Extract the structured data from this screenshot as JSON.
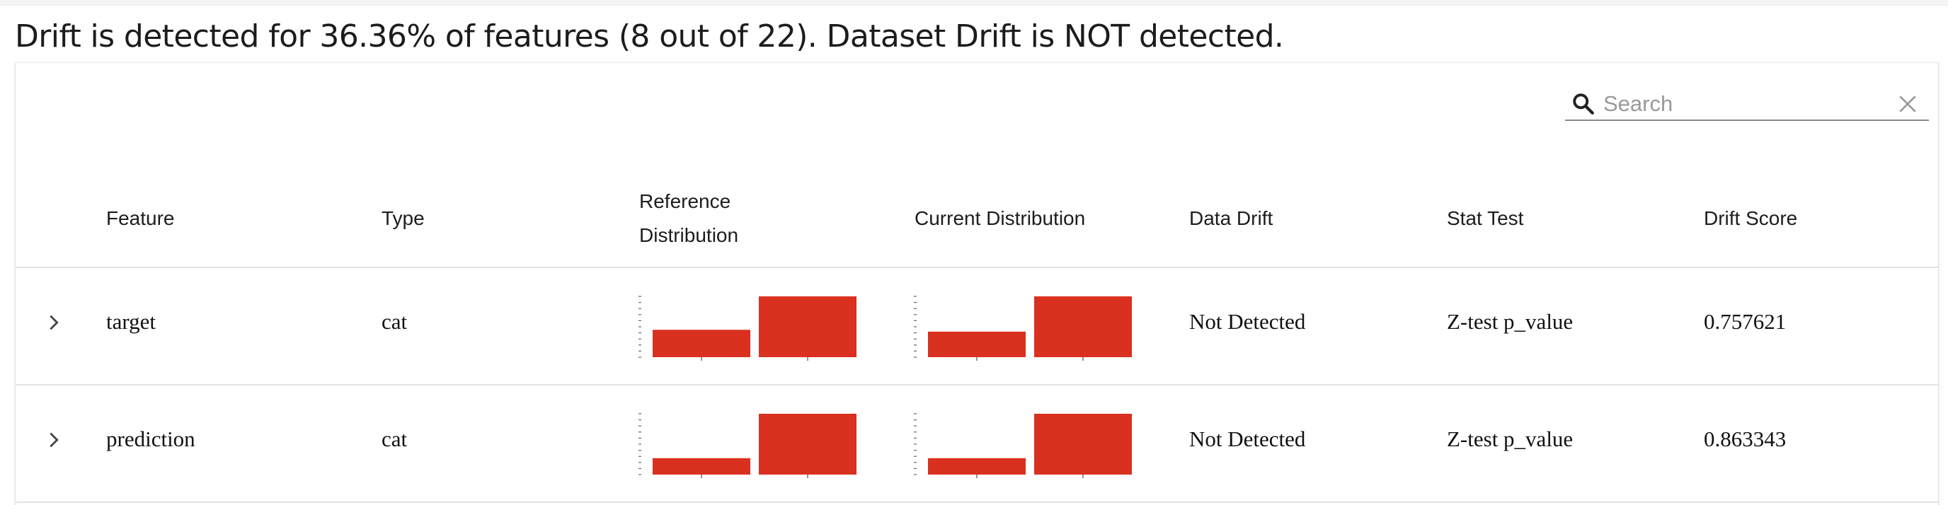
{
  "summary": "Drift is detected for 36.36% of features (8 out of 22). Dataset Drift is NOT detected.",
  "search": {
    "placeholder": "Search",
    "value": ""
  },
  "icons": {
    "search": "search-icon",
    "clear": "close-icon",
    "expand": "chevron-right-icon"
  },
  "colors": {
    "bar": "#d93020",
    "text": "#1a1a1a",
    "divider": "#e3e3e3"
  },
  "columns": {
    "feature": "Feature",
    "type": "Type",
    "reference_line1": "Reference",
    "reference_line2": "Distribution",
    "current": "Current Distribution",
    "data_drift": "Data Drift",
    "stat_test": "Stat Test",
    "drift_score": "Drift Score"
  },
  "rows": [
    {
      "feature": "target",
      "type": "cat",
      "reference_distribution": [
        0.45,
        1.0
      ],
      "current_distribution": [
        0.42,
        1.0
      ],
      "data_drift": "Not Detected",
      "stat_test": "Z-test p_value",
      "drift_score": "0.757621"
    },
    {
      "feature": "prediction",
      "type": "cat",
      "reference_distribution": [
        0.27,
        1.0
      ],
      "current_distribution": [
        0.27,
        1.0
      ],
      "data_drift": "Not Detected",
      "stat_test": "Z-test p_value",
      "drift_score": "0.863343"
    }
  ]
}
